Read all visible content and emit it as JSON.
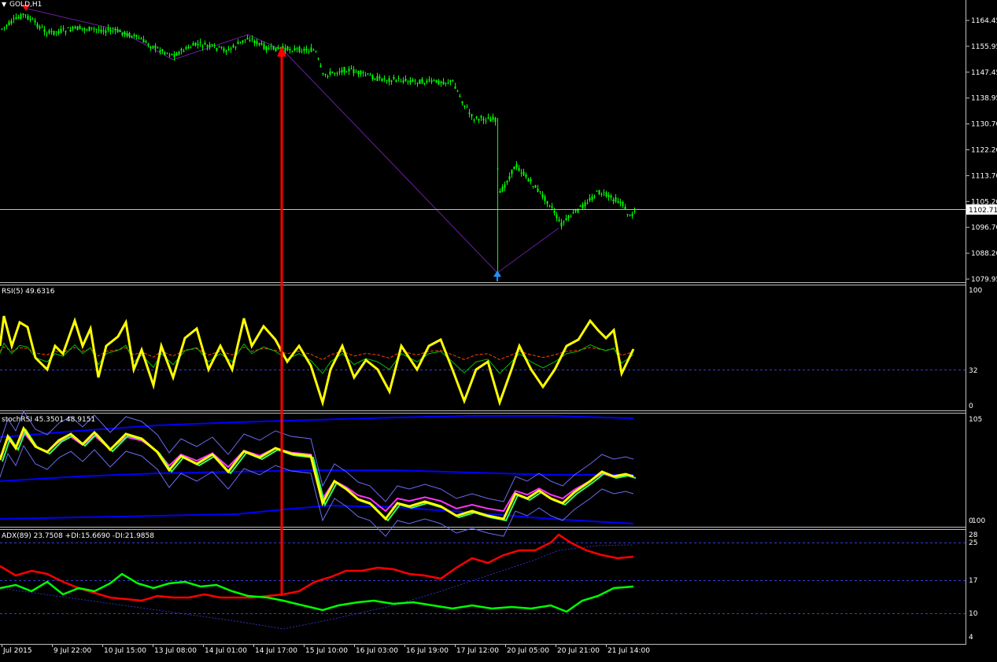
{
  "main": {
    "title": "GOLD,H1",
    "current_price": "1102.71",
    "axis_labels": [
      "1164.45",
      "1155.95",
      "1147.45",
      "1138.95",
      "1130.70",
      "1122.20",
      "1113.70",
      "1105.20",
      "1096.70",
      "1088.20",
      "1079.95"
    ],
    "candle_color": "#00ff00",
    "zigzag_color": "#6a1fa0",
    "arrow_color": "#ff0000",
    "buy_arrow_color": "#1e90ff"
  },
  "rsi": {
    "label": "RSI(5) 49.6316",
    "axis_labels": [
      "100",
      "32",
      "0"
    ],
    "line_color": "#ffff00"
  },
  "stoch_rsi": {
    "label": "stochRSI 45.3501 48.9151",
    "axis_labels": [
      "105",
      "0",
      "100"
    ],
    "band_color": "#0000ff"
  },
  "adx": {
    "label": "ADX(89) 23.7508 +DI:15.6690 -DI:21.9858",
    "axis_labels": [
      "28",
      "25",
      "17",
      "10",
      "4"
    ],
    "plus_di_color": "#00ff00",
    "minus_di_color": "#ff0000"
  },
  "time_axis": {
    "labels": [
      "Jul 2015",
      "9 Jul 22:00",
      "10 Jul 15:00",
      "13 Jul 08:00",
      "14 Jul 01:00",
      "14 Jul 17:00",
      "15 Jul 10:00",
      "16 Jul 03:00",
      "16 Jul 19:00",
      "17 Jul 12:00",
      "20 Jul 05:00",
      "20 Jul 21:00",
      "21 Jul 14:00"
    ]
  }
}
